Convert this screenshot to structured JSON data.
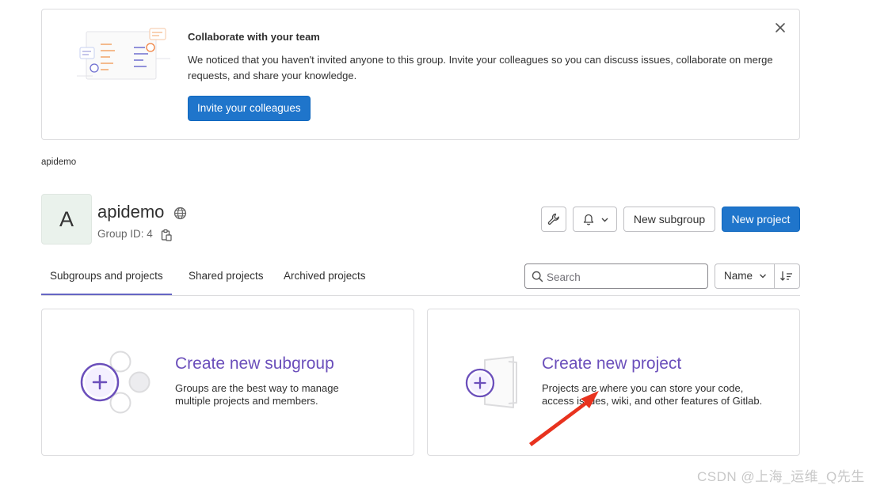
{
  "invite": {
    "title": "Collaborate with your team",
    "body": "We noticed that you haven't invited anyone to this group. Invite your colleagues so you can discuss issues, collaborate on merge requests, and share your knowledge.",
    "button_label": "Invite your colleagues",
    "close_icon": "close-icon"
  },
  "breadcrumb": {
    "label": "apidemo"
  },
  "group": {
    "avatar_letter": "A",
    "name": "apidemo",
    "visibility_icon": "globe-icon",
    "id_label": "Group ID: 4"
  },
  "actions": {
    "settings_icon": "wrench-icon",
    "notifications_icon": "bell-icon",
    "new_subgroup": "New subgroup",
    "new_project": "New project"
  },
  "tabs": [
    {
      "label": "Subgroups and projects",
      "active": true
    },
    {
      "label": "Shared projects",
      "active": false
    },
    {
      "label": "Archived projects",
      "active": false
    }
  ],
  "search": {
    "placeholder": "Search"
  },
  "sort": {
    "label": "Name"
  },
  "cards": {
    "subgroup": {
      "title": "Create new subgroup",
      "line1": "Groups are the best way to manage",
      "line2": "multiple projects and members."
    },
    "project": {
      "title": "Create new project",
      "line1": "Projects are where you can store your code,",
      "line2": "access issues, wiki, and other features of Gitlab."
    }
  },
  "watermark": "CSDN @上海_运维_Q先生",
  "colors": {
    "primary": "#1f75cb",
    "purple": "#6b4fbb",
    "tab_underline": "#6666c4",
    "annotation_red": "#e8321e"
  }
}
